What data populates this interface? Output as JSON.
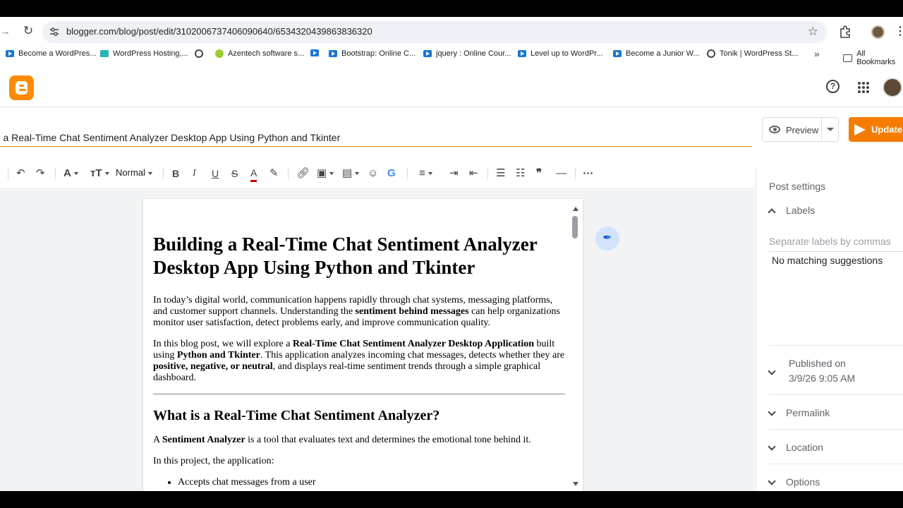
{
  "browser": {
    "url": "blogger.com/blog/post/edit/3102006737406090640/6534320439863836320",
    "bookmarks": [
      {
        "label": "Become a WordPres...",
        "icon": "youtube-icon"
      },
      {
        "label": "WordPress Hosting,...",
        "icon": "wordpress-icon"
      },
      {
        "label": "",
        "icon": "globe-icon"
      },
      {
        "label": "Azentech software s...",
        "icon": "azentech-icon"
      },
      {
        "label": "",
        "icon": "youtube-icon"
      },
      {
        "label": "Bootstrap: Online C...",
        "icon": "youtube-icon"
      },
      {
        "label": "jquery : Online Cour...",
        "icon": "youtube-icon"
      },
      {
        "label": "Level up to WordPr...",
        "icon": "youtube-icon"
      },
      {
        "label": "Become a Junior W...",
        "icon": "youtube-icon"
      },
      {
        "label": "Tonik | WordPress St...",
        "icon": "globe-icon"
      }
    ],
    "more_bookmarks": "»",
    "all_bookmarks": "All Bookmarks"
  },
  "editor": {
    "post_title": "ng a Real-Time Chat Sentiment Analyzer Desktop App Using Python and Tkinter",
    "preview_label": "Preview",
    "update_label": "Update",
    "format_label": "Normal"
  },
  "content": {
    "h1": "Building a Real-Time Chat Sentiment Analyzer Desktop App Using Python and Tkinter",
    "p1_a": "In today’s digital world, communication happens rapidly through chat systems, messaging platforms, and customer support channels. Understanding the ",
    "p1_b": "sentiment behind messages",
    "p1_c": " can help organizations monitor user satisfaction, detect problems early, and improve communication quality.",
    "p2_a": "In this blog post, we will explore a ",
    "p2_b": "Real-Time Chat Sentiment Analyzer Desktop Application",
    "p2_c": " built using ",
    "p2_d": "Python and Tkinter",
    "p2_e": ". This application analyzes incoming chat messages, detects whether they are ",
    "p2_f": "positive, negative, or neutral",
    "p2_g": ", and displays real-time sentiment trends through a simple graphical dashboard.",
    "h2": "What is a Real-Time Chat Sentiment Analyzer?",
    "p3_a": "A ",
    "p3_b": "Sentiment Analyzer",
    "p3_c": " is a tool that evaluates text and determines the emotional tone behind it.",
    "p4": "In this project, the application:",
    "li1": "Accepts chat messages from a user"
  },
  "sidebar": {
    "title": "Post settings",
    "labels": "Labels",
    "labels_placeholder": "Separate labels by commas",
    "no_match": "No matching suggestions",
    "published_label": "Published on",
    "published_date": "3/9/26 9:05 AM",
    "permalink": "Permalink",
    "location": "Location",
    "options": "Options"
  },
  "colors": {
    "brand": "#ff8a00",
    "update": "#f57c00"
  }
}
